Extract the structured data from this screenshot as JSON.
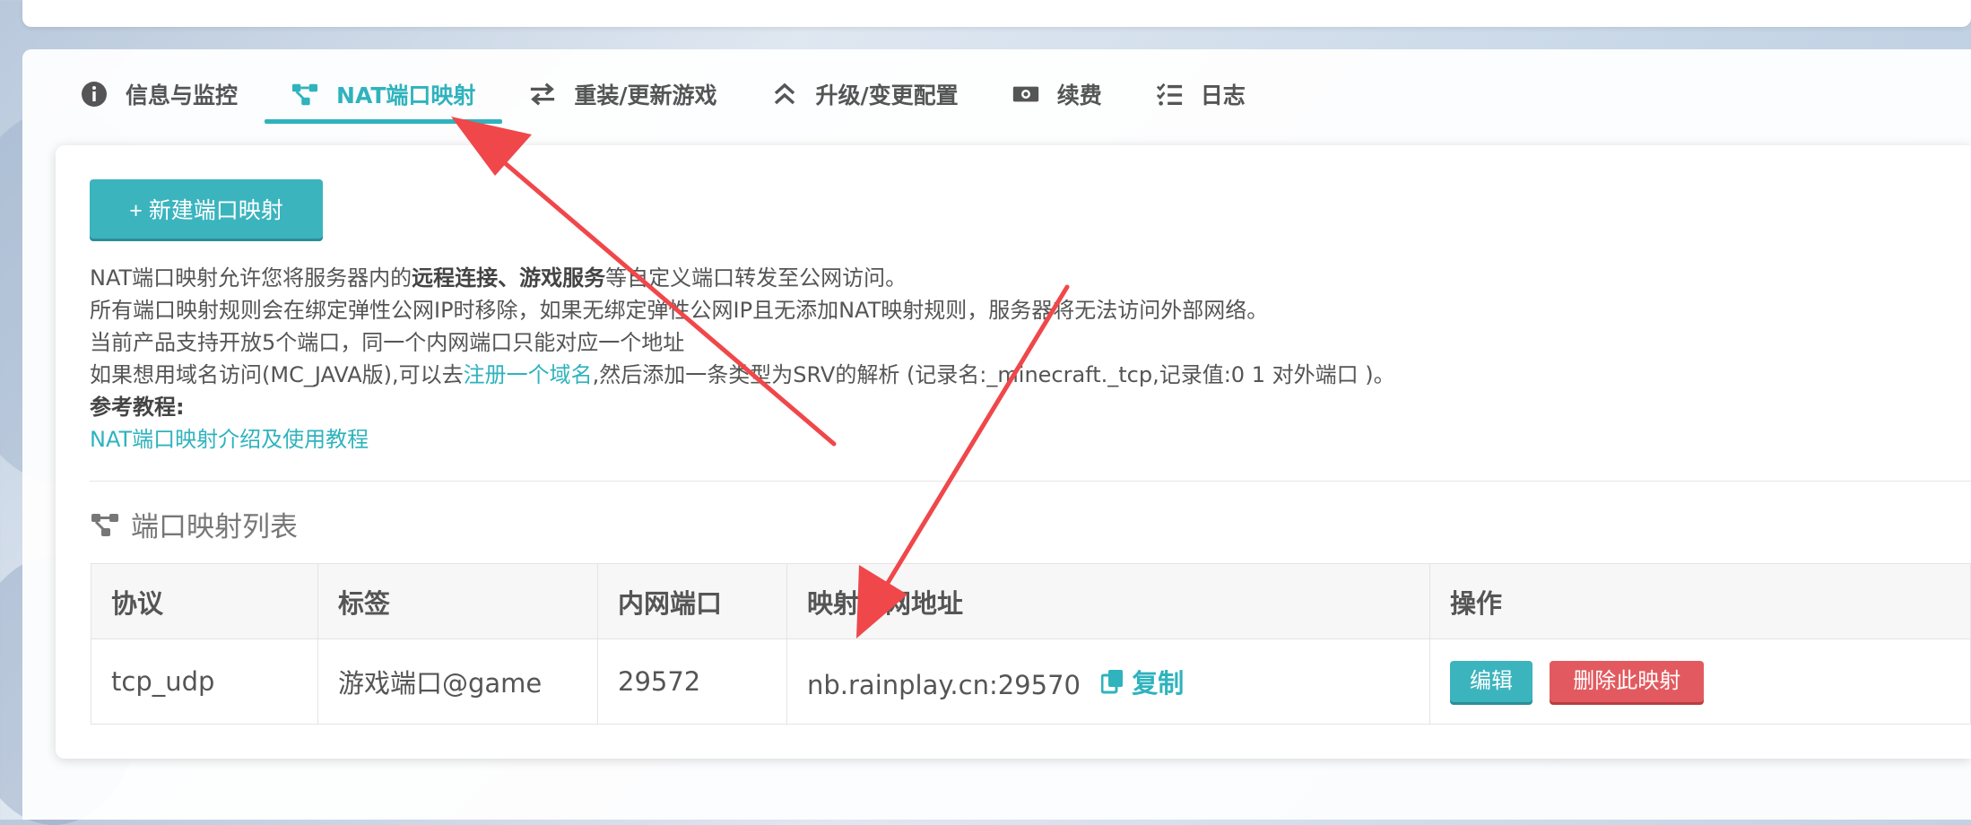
{
  "tabs": [
    {
      "label": "信息与监控",
      "icon": "info-circle-icon"
    },
    {
      "label": "NAT端口映射",
      "icon": "nodes-icon"
    },
    {
      "label": "重装/更新游戏",
      "icon": "swap-arrows-icon"
    },
    {
      "label": "升级/变更配置",
      "icon": "double-chevron-up-icon"
    },
    {
      "label": "续费",
      "icon": "money-icon"
    },
    {
      "label": "日志",
      "icon": "checklist-icon"
    }
  ],
  "active_tab": "NAT端口映射",
  "new_mapping_button": "+ 新建端口映射",
  "description": {
    "line1_a": "NAT端口映射允许您将服务器内的",
    "line1_bold": "远程连接、游戏服务",
    "line1_b": "等自定义端口转发至公网访问。",
    "line2": "所有端口映射规则会在绑定弹性公网IP时移除，如果无绑定弹性公网IP且无添加NAT映射规则，服务器将无法访问外部网络。",
    "line3": "当前产品支持开放5个端口，同一个内网端口只能对应一个地址",
    "line4_a": "如果想用域名访问(MC_JAVA版),可以去",
    "line4_link": "注册一个域名",
    "line4_b": ",然后添加一条类型为SRV的解析 (记录名:_minecraft._tcp,记录值:0 1 对外端口 )。",
    "ref_label": "参考教程:",
    "ref_link": "NAT端口映射介绍及使用教程"
  },
  "section_title": "端口映射列表",
  "table": {
    "headers": [
      "协议",
      "标签",
      "内网端口",
      "映射公网地址",
      "操作"
    ],
    "rows": [
      {
        "protocol": "tcp_udp",
        "tag": "游戏端口@game",
        "internal_port": "29572",
        "public_address": "nb.rainplay.cn:29570"
      }
    ],
    "copy_label": "复制",
    "edit_label": "编辑",
    "delete_label": "删除此映射"
  },
  "colors": {
    "accent": "#2fb3bd",
    "danger": "#e25a5f",
    "annotation": "#f0474a"
  }
}
